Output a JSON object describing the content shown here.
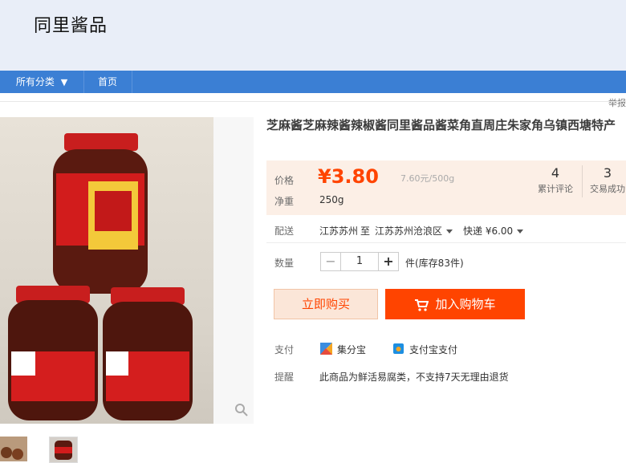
{
  "shop": {
    "logo_text": "同里酱品"
  },
  "nav": {
    "category_label": "所有分类",
    "home_label": "首页"
  },
  "report_label": "举报",
  "product": {
    "title": "芝麻酱芝麻辣酱辣椒酱同里酱品酱菜角直周庄朱家角乌镇西塘特产",
    "price_label": "价格",
    "price": "¥3.80",
    "unit_price": "7.60元/500g",
    "weight_label": "净重",
    "weight": "250g",
    "reviews_count": "4",
    "reviews_label": "累计评论",
    "sales_count": "3",
    "sales_label": "交易成功"
  },
  "shipping": {
    "label": "配送",
    "from": "江苏苏州",
    "to_word": "至",
    "destination": "江苏苏州沧浪区",
    "method": "快递 ¥6.00"
  },
  "quantity": {
    "label": "数量",
    "minus": "−",
    "value": "1",
    "plus": "+",
    "stock_text": "件(库存83件)"
  },
  "buttons": {
    "buy_now": "立即购买",
    "add_to_cart": "加入购物车"
  },
  "payment": {
    "label": "支付",
    "options": [
      "集分宝",
      "支付宝支付"
    ]
  },
  "notice": {
    "label": "提醒",
    "text": "此商品为鲜活易腐类，不支持7天无理由退货"
  },
  "colors": {
    "nav": "#3b7fd4",
    "price": "#ff4400",
    "cart_button": "#ff4400",
    "price_bg": "#fcefe6"
  }
}
